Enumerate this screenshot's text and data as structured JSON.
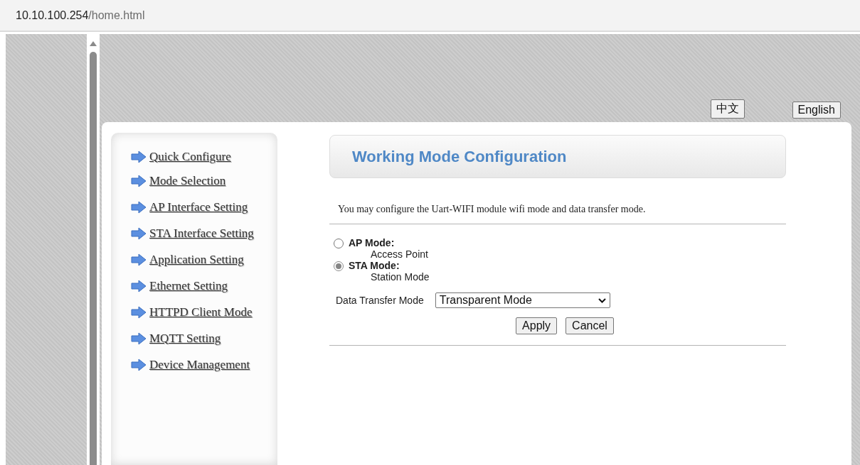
{
  "address_bar": {
    "host": "10.10.100.254",
    "path": "/home.html"
  },
  "language_buttons": [
    "中文",
    "English"
  ],
  "menu": [
    {
      "label": "Quick Configure"
    },
    {
      "label": "Mode Selection"
    },
    {
      "label": "AP Interface Setting"
    },
    {
      "label": "STA Interface Setting"
    },
    {
      "label": "Application Setting"
    },
    {
      "label": "Ethernet Setting"
    },
    {
      "label": "HTTPD Client Mode"
    },
    {
      "label": "MQTT Setting"
    },
    {
      "label": "Device Management"
    }
  ],
  "title": "Working Mode Configuration",
  "description": "You may configure the Uart-WIFI module wifi mode and data transfer mode.",
  "modes": [
    {
      "label": "AP Mode:",
      "subtitle": "Access Point",
      "selected": false
    },
    {
      "label": "STA Mode:",
      "subtitle": "Station Mode",
      "selected": true
    }
  ],
  "transfer_mode": {
    "label": "Data Transfer Mode",
    "value": "Transparent Mode"
  },
  "buttons": [
    "Apply",
    "Cancel"
  ]
}
